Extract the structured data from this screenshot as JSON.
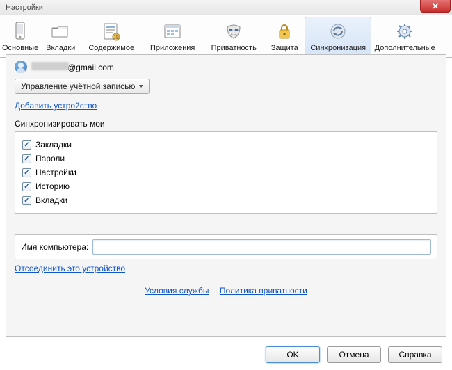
{
  "window": {
    "title": "Настройки"
  },
  "tabs": {
    "general": "Основные",
    "tabs": "Вкладки",
    "content": "Содержимое",
    "apps": "Приложения",
    "privacy": "Приватность",
    "security": "Защита",
    "sync": "Синхронизация",
    "advanced": "Дополнительные"
  },
  "user": {
    "email_suffix": "@gmail.com"
  },
  "buttons": {
    "manage_account": "Управление учётной записью",
    "ok": "OK",
    "cancel": "Отмена",
    "help": "Справка"
  },
  "links": {
    "add_device": "Добавить устройство",
    "disconnect_device": "Отсоединить это устройство",
    "tos": "Условия службы",
    "privacy_policy": "Политика приватности"
  },
  "sync": {
    "heading": "Синхронизировать мои",
    "items": {
      "bookmarks": "Закладки",
      "passwords": "Пароли",
      "prefs": "Настройки",
      "history": "Историю",
      "tabs": "Вкладки"
    }
  },
  "computer_name": {
    "label": "Имя компьютера:",
    "value": ""
  }
}
